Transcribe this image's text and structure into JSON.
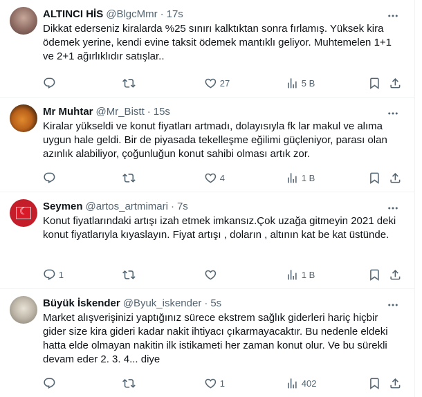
{
  "tweets": [
    {
      "name": "ALTINCI HİS",
      "handle": "@BlgcMmr",
      "dot": "·",
      "time": "17s",
      "text": "Dikkat ederseniz kiralarda %25 sınırı kalktıktan sonra fırlamış. Yüksek kira ödemek yerine, kendi evine taksit ödemek mantıklı geliyor. Muhtemelen 1+1 ve 2+1 ağırlıklıdır satışlar..",
      "replies": "",
      "retweets": "",
      "likes": "27",
      "views": "5 B",
      "avatar_icon": "profile-photo"
    },
    {
      "name": "Mr Muhtar",
      "handle": "@Mr_Bistt",
      "dot": "·",
      "time": "15s",
      "text": "Kiralar yükseldi ve konut fiyatları artmadı, dolayısıyla fk lar makul ve alıma uygun hale geldi. Bir de piyasada tekelleşme eğilimi güçleniyor, parası olan azınlık alabiliyor, çoğunluğun konut sahibi olması artık zor.",
      "replies": "",
      "retweets": "",
      "likes": "4",
      "views": "1 B",
      "avatar_icon": "cat-photo"
    },
    {
      "name": "Seymen",
      "handle": "@artos_artmimari",
      "dot": "·",
      "time": "7s",
      "text": "Konut fiyatlarındaki artışı izah etmek imkansız.Çok uzağa gitmeyin 2021 deki konut fiyatlarıyla kıyaslayın. Fiyat artışı , doların , altının kat be kat üstünde.",
      "replies": "1",
      "retweets": "",
      "likes": "",
      "views": "1 B",
      "avatar_icon": "turkish-flag"
    },
    {
      "name": "Büyük İskender",
      "handle": "@Byuk_iskender",
      "dot": "·",
      "time": "5s",
      "text": "Market alışverişinizi yaptığınız sürece ekstrem sağlık giderleri hariç hiçbir gider size kira gideri kadar nakit ihtiyacı çıkarmayacaktır. Bu nedenle eldeki hatta elde olmayan nakitin ilk istikameti her zaman konut olur. Ve bu sürekli devam eder 2. 3. 4... diye",
      "replies": "",
      "retweets": "",
      "likes": "1",
      "views": "402",
      "avatar_icon": "statue-bust"
    }
  ],
  "colors": {
    "text": "#0f1419",
    "secondary": "#536471",
    "border": "#eff3f4"
  }
}
